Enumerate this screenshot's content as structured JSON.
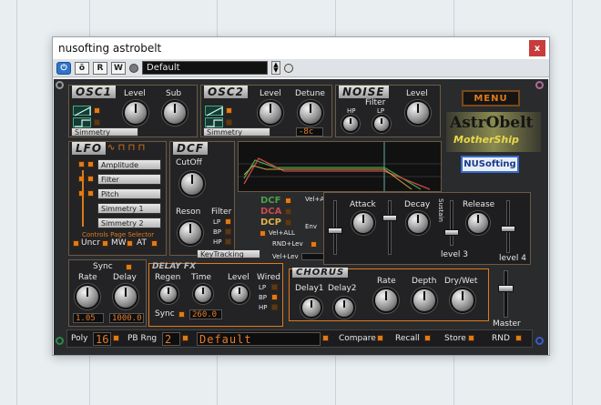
{
  "window": {
    "title": "nusofting astrobelt",
    "close_glyph": "x"
  },
  "toolbar": {
    "power_glyph": "⏻",
    "compare_glyph": "ō",
    "read_label": "R",
    "write_label": "W",
    "preset_name": "Default"
  },
  "osc1": {
    "title": "OSC1",
    "level_label": "Level",
    "sub_label": "Sub",
    "shape_value": "Simmetry"
  },
  "osc2": {
    "title": "OSC2",
    "level_label": "Level",
    "detune_label": "Detune",
    "shape_value": "Simmetry",
    "detune_value": "-8c"
  },
  "noise": {
    "title": "NOISE",
    "filter_label": "Filter",
    "hp_label": "HP",
    "lp_label": "LP",
    "level_label": "Level"
  },
  "menu_label": "MENU",
  "logo": {
    "line1": "AstrObelt",
    "line2": "MotherShip",
    "brand": "NUSofting"
  },
  "lfo": {
    "title": "LFO",
    "shapes_glyphs": "∿ ⊓ ⊓ ⊓",
    "targets": [
      "Amplitude",
      "Filter",
      "Pitch",
      "Simmetry 1",
      "Simmetry 2"
    ],
    "selector_label": "Controls Page Selector",
    "uncr_label": "Uncr",
    "mw_label": "MW",
    "at_label": "AT"
  },
  "dcf": {
    "title": "DCF",
    "cutoff_label": "CutOff",
    "reson_label": "Reson",
    "filter_label": "Filter",
    "modes": [
      "LP",
      "BP",
      "HP"
    ],
    "keytrack_value": "KeyTracking"
  },
  "env": {
    "dcf_tag": "DCF",
    "dca_tag": "DCA",
    "dcp_tag": "DCP",
    "velatk_label": "Vel+Atk",
    "env_label": "Env",
    "velall_label": "Vel+ALL",
    "rndlev_label": "RND+Lev",
    "vellev_label": "Vel+Lev",
    "attack_label": "Attack",
    "decay_label": "Decay",
    "sustain_label": "Sustain",
    "release_label": "Release",
    "level3_label": "level 3",
    "level4_label": "level 4"
  },
  "sync": {
    "label": "Sync",
    "rate_label": "Rate",
    "delay_label": "Delay",
    "rate_value": "1.05",
    "delay_value": "1000.0"
  },
  "delay_fx": {
    "title": "DELAY FX",
    "regen_label": "Regen",
    "time_label": "Time",
    "level_label": "Level",
    "wired_label": "Wired",
    "sync_label": "Sync",
    "time_value": "260.0",
    "modes": [
      "LP",
      "BP",
      "HP"
    ]
  },
  "chorus": {
    "title": "CHORUS",
    "delay1_label": "Delay1",
    "delay2_label": "Delay2",
    "rate_label": "Rate",
    "depth_label": "Depth",
    "drywet_label": "Dry/Wet"
  },
  "master_label": "Master",
  "footer": {
    "poly_label": "Poly",
    "poly_value": "16",
    "pbrng_label": "PB Rng",
    "pbrng_value": "2",
    "preset_display": "Default",
    "compare_label": "Compare",
    "recall_label": "Recall",
    "store_label": "Store",
    "rnd_label": "RND"
  },
  "colors": {
    "accent": "#e07a1a",
    "panel": "#232325",
    "chrome": "#2a2b2d"
  }
}
